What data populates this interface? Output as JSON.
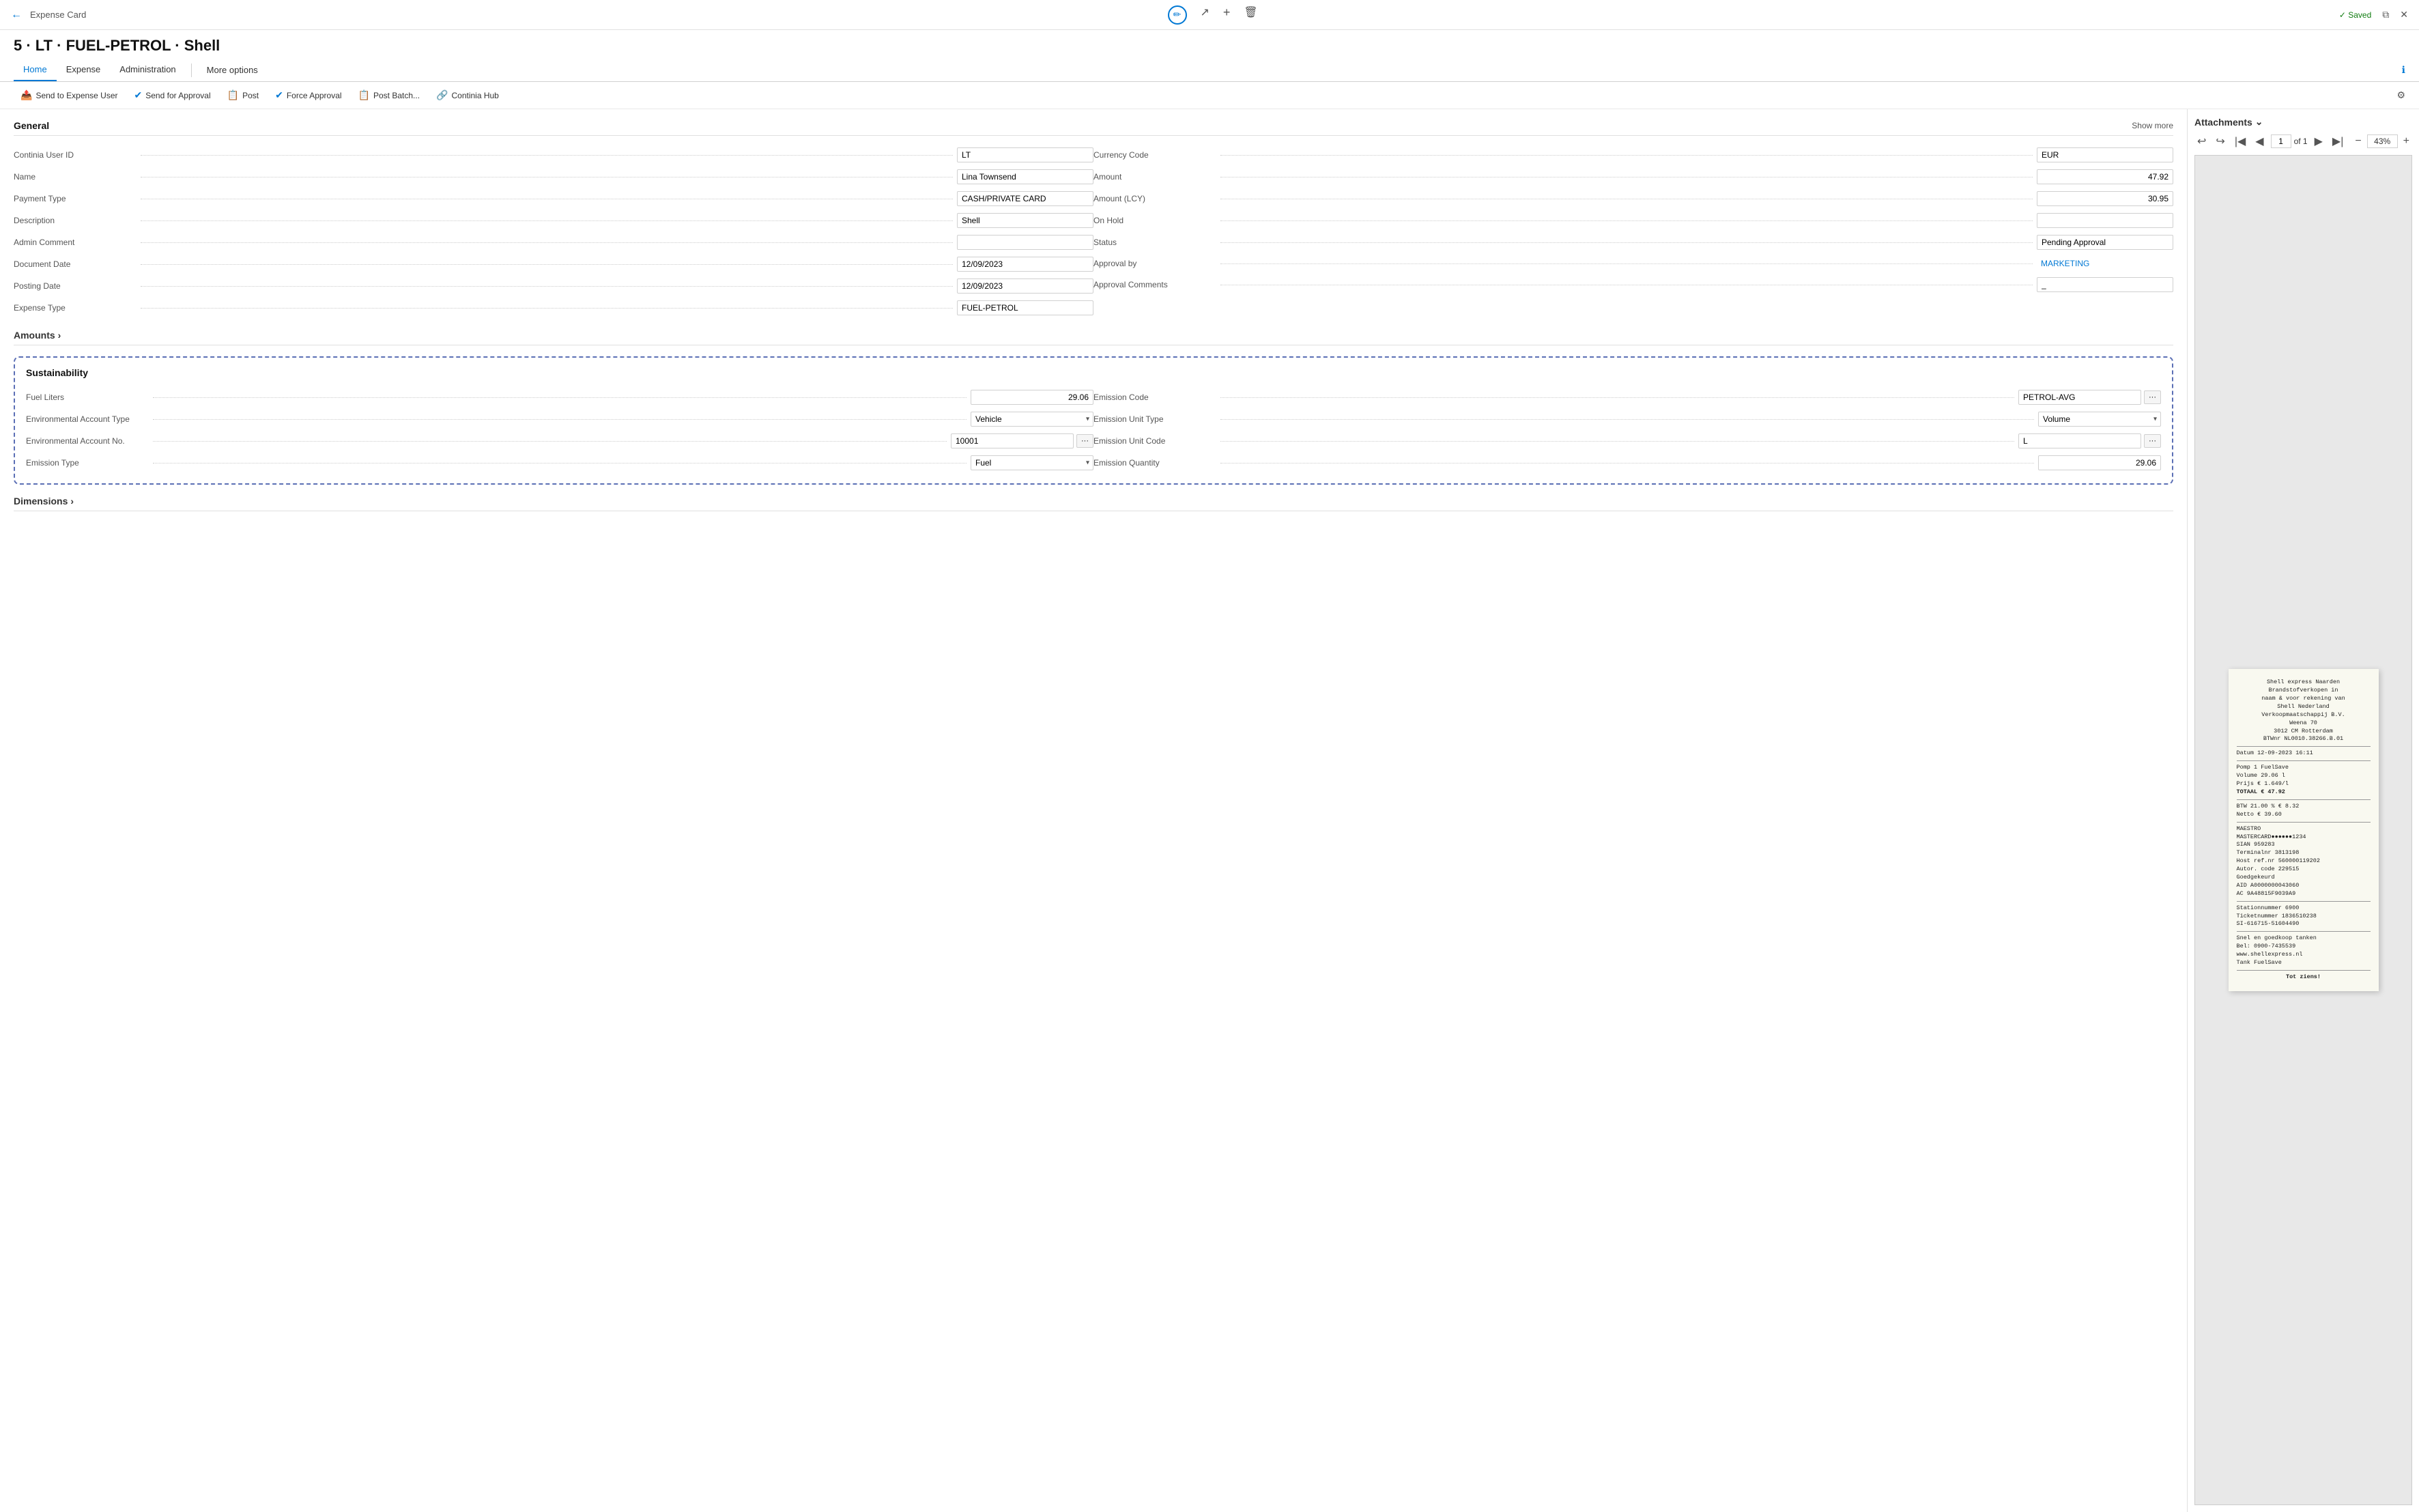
{
  "topbar": {
    "page_label": "Expense Card",
    "saved_label": "Saved",
    "center_icons": [
      "✏️",
      "↗",
      "+",
      "🗑"
    ]
  },
  "title": "5 · LT · FUEL-PETROL · Shell",
  "tabs": [
    {
      "label": "Home",
      "active": true
    },
    {
      "label": "Expense",
      "active": false
    },
    {
      "label": "Administration",
      "active": false
    },
    {
      "label": "More options",
      "active": false
    }
  ],
  "actions": [
    {
      "label": "Send to Expense User",
      "icon": "📤"
    },
    {
      "label": "Send for Approval",
      "icon": "✔"
    },
    {
      "label": "Post",
      "icon": "📋"
    },
    {
      "label": "Force Approval",
      "icon": "✔"
    },
    {
      "label": "Post Batch...",
      "icon": "📋"
    },
    {
      "label": "Continia Hub",
      "icon": "🔗"
    }
  ],
  "general": {
    "title": "General",
    "show_more": "Show more",
    "left_fields": [
      {
        "label": "Continia User ID",
        "value": "LT",
        "style": "input"
      },
      {
        "label": "Name",
        "value": "Lina Townsend",
        "style": "input"
      },
      {
        "label": "Payment Type",
        "value": "CASH/PRIVATE CARD",
        "style": "input"
      },
      {
        "label": "Description",
        "value": "Shell",
        "style": "input"
      },
      {
        "label": "Admin Comment",
        "value": "",
        "style": "input"
      },
      {
        "label": "Document Date",
        "value": "12/09/2023",
        "style": "input"
      },
      {
        "label": "Posting Date",
        "value": "12/09/2023",
        "style": "input"
      },
      {
        "label": "Expense Type",
        "value": "FUEL-PETROL",
        "style": "input"
      }
    ],
    "right_fields": [
      {
        "label": "Currency Code",
        "value": "EUR",
        "style": "input"
      },
      {
        "label": "Amount",
        "value": "47.92",
        "style": "input",
        "align": "right"
      },
      {
        "label": "Amount (LCY)",
        "value": "30.95",
        "style": "input",
        "align": "right"
      },
      {
        "label": "On Hold",
        "value": "",
        "style": "input"
      },
      {
        "label": "Status",
        "value": "Pending Approval",
        "style": "input"
      },
      {
        "label": "Approval by",
        "value": "MARKETING",
        "style": "link"
      },
      {
        "label": "Approval Comments",
        "value": "_",
        "style": "input"
      }
    ]
  },
  "amounts": {
    "title": "Amounts"
  },
  "sustainability": {
    "title": "Sustainability",
    "fields_left": [
      {
        "label": "Fuel Liters",
        "value": "29.06",
        "type": "input"
      },
      {
        "label": "Environmental Account Type",
        "value": "Vehicle",
        "type": "select"
      },
      {
        "label": "Environmental Account No.",
        "value": "10001",
        "type": "input-dots"
      },
      {
        "label": "Emission Type",
        "value": "Fuel",
        "type": "select"
      }
    ],
    "fields_right": [
      {
        "label": "Emission Code",
        "value": "PETROL-AVG",
        "type": "input-dots"
      },
      {
        "label": "Emission Unit Type",
        "value": "Volume",
        "type": "select"
      },
      {
        "label": "Emission Unit Code",
        "value": "L",
        "type": "input-dots"
      },
      {
        "label": "Emission Quantity",
        "value": "29.06",
        "type": "input"
      }
    ]
  },
  "dimensions": {
    "title": "Dimensions"
  },
  "attachments": {
    "title": "Attachments",
    "page_current": "1",
    "page_total": "of 1",
    "zoom": "43%",
    "receipt": {
      "line1": "Shell express Naarden",
      "line2": "Brandstofverkopen in",
      "line3": "naam & voor rekening van",
      "line4": "Shell Nederland",
      "line5": "Verkoopmaatschappij B.V.",
      "line6": "Weena 70",
      "line7": "3012 CM Rotterdam",
      "line8": "BTWnr NL0010.38266.B.01",
      "blank1": "",
      "date_label": "Datum    12-09-2023 16:11",
      "blank2": "",
      "pump": "Pomp 1          FuelSave",
      "volume": "Volume              29.06 l",
      "price": "Prijs            € 1.649/l",
      "total": "TOTAAL           € 47.92",
      "blank3": "",
      "btw": "BTW   21.00 %       € 8.32",
      "netto": "Netto               € 39.60",
      "maestro": "MAESTRO",
      "mastercard": "MASTERCARD●●●●●●1234",
      "sian": "SIAN                959283",
      "terminal": "Terminalnr        3813198",
      "host": "Host ref.nr  560000119202",
      "auth": "Autor. code          229515",
      "goedgekeurd": "Goedgekeurd",
      "aid": "AID      A0000000043060",
      "ac": "AC       9A48815F9039A9",
      "blank4": "",
      "station": "Stationnummer        6900",
      "ticket": "Ticketnummer  1836510238",
      "si": "SI-616715-51604490",
      "blank5": "",
      "slogan": "Snel en goedkoop tanken",
      "phone": "Bel: 0900-7435539",
      "website": "www.shellexpress.nl",
      "tank": "Tank FuelSave",
      "blank6": "",
      "goodbye": "Tot ziens!"
    }
  }
}
